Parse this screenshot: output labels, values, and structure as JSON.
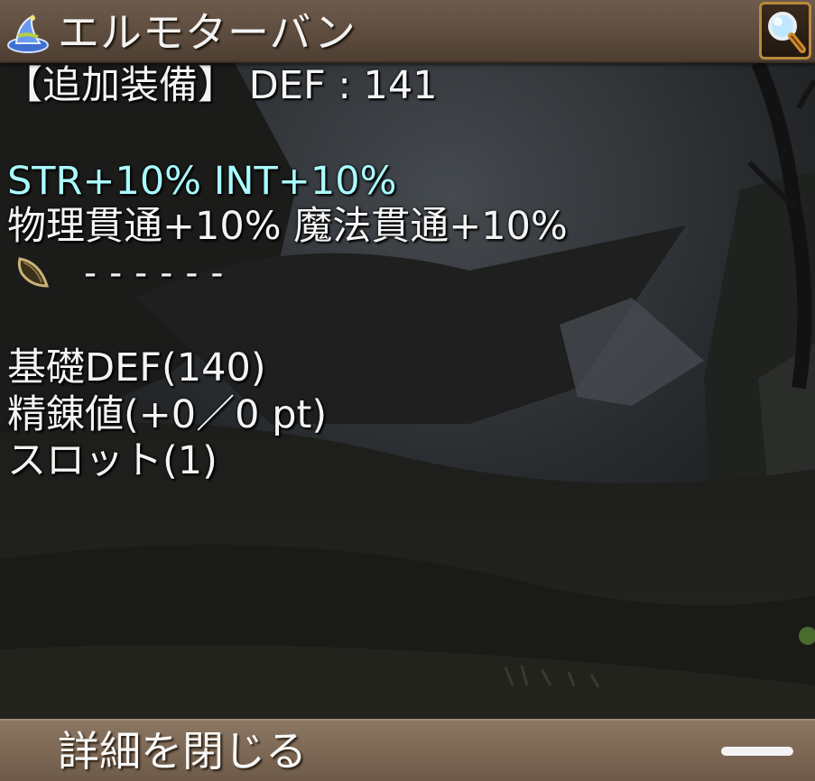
{
  "title_bar": {
    "item_name": "エルモターバン",
    "item_icon": "wizard-hat-icon",
    "zoom_icon": "magnifier-icon"
  },
  "stats": {
    "equip_line": "【追加装備】 DEF : 141",
    "bonus_line": "STR+10% INT+10%",
    "penetration_line": "物理貫通+10% 魔法貫通+10%",
    "slot_icon": "seed-icon",
    "slot_value": "------",
    "base_def": "基礎DEF(140)",
    "refine": "精錬値(+0／0 pt)",
    "slots": "スロット(1)"
  },
  "footer": {
    "close_label": "詳細を閉じる"
  },
  "colors": {
    "title_bar_bg": "#5e4d3f",
    "footer_bg": "#7d6855",
    "bonus_text": "#a9fbff",
    "text": "#f4f4f4",
    "zoom_border": "#b98a3c"
  }
}
